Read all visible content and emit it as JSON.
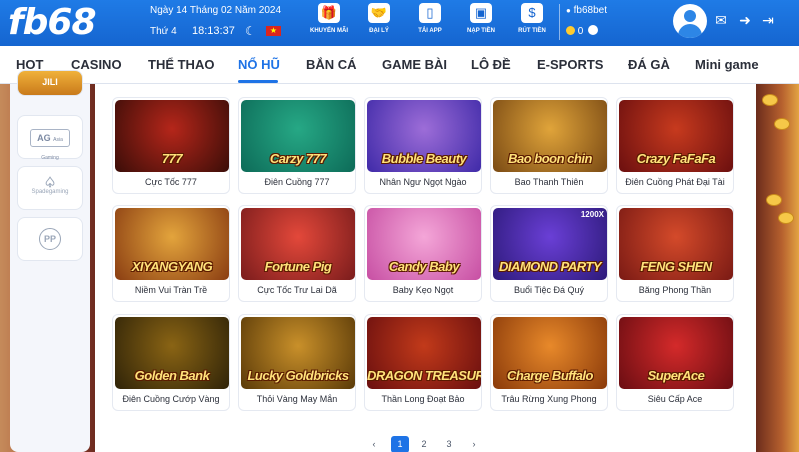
{
  "header": {
    "logo": "fb68",
    "date": "Ngày 14 Tháng 02 Năm 2024",
    "weekday": "Thứ 4",
    "time": "18:13:37",
    "theme_icon": "moon-icon",
    "flag": "vietnam-flag",
    "tools": [
      {
        "label": "KHUYẾN MÃI",
        "icon": "gift-icon"
      },
      {
        "label": "ĐẠI LÝ",
        "icon": "handshake-icon"
      },
      {
        "label": "TẢI APP",
        "icon": "phone-icon"
      },
      {
        "label": "NẠP TIỀN",
        "icon": "wallet-icon"
      },
      {
        "label": "RÚT TIỀN",
        "icon": "withdraw-icon"
      }
    ],
    "username": "fb68bet",
    "balance": "0",
    "icons": [
      "avatar-icon",
      "mail-icon",
      "login-icon",
      "logout-icon"
    ]
  },
  "nav": {
    "items": [
      "HOT",
      "CASINO",
      "THỂ THAO",
      "NỔ HŨ",
      "BẮN CÁ",
      "GAME BÀI",
      "LÔ ĐỀ",
      "E-SPORTS",
      "ĐÁ GÀ",
      "Mini game"
    ],
    "active": "NỔ HŨ"
  },
  "rail": {
    "items": [
      {
        "label": "JILI",
        "icon": "jili-logo"
      },
      {
        "label": "AG",
        "sub": "Asia Gaming",
        "icon": "ag-logo"
      },
      {
        "label": "Spadegaming",
        "icon": "spadegaming-logo"
      },
      {
        "label": "PP",
        "icon": "pp-logo"
      }
    ]
  },
  "games": [
    {
      "name": "Cực Tốc 777",
      "art": "777",
      "colors": [
        "#3a0d08",
        "#b5261a"
      ]
    },
    {
      "name": "Điên Cuồng 777",
      "art": "Carzy 777",
      "colors": [
        "#0d6b58",
        "#26a885"
      ]
    },
    {
      "name": "Nhân Ngư Ngọt Ngào",
      "art": "Bubble Beauty",
      "colors": [
        "#3f2aa8",
        "#9d6dd8"
      ]
    },
    {
      "name": "Bao Thanh Thiên",
      "art": "Bao boon chin",
      "colors": [
        "#7a4a14",
        "#e0a43a"
      ]
    },
    {
      "name": "Điên Cuồng Phát Đại Tài",
      "art": "Crazy FaFaFa",
      "colors": [
        "#6b0f0f",
        "#c73a1e"
      ]
    },
    {
      "name": "Niềm Vui Tràn Trề",
      "art": "XIYANGYANG",
      "colors": [
        "#8a3d12",
        "#e3a43c"
      ]
    },
    {
      "name": "Cực Tốc Trư Lai Dã",
      "art": "Fortune Pig",
      "colors": [
        "#7a1c1c",
        "#e3483a"
      ]
    },
    {
      "name": "Baby Kẹo Ngọt",
      "art": "Candy Baby",
      "colors": [
        "#c74fa3",
        "#f4a6d8"
      ]
    },
    {
      "name": "Buổi Tiệc Đá Quý",
      "art": "DIAMOND PARTY",
      "colors": [
        "#2d1a7a",
        "#6a3fd6"
      ]
    },
    {
      "name": "Băng Phong Thần",
      "art": "FENG SHEN",
      "colors": [
        "#7a1a14",
        "#d44a2a"
      ]
    },
    {
      "name": "Điên Cuồng Cướp Vàng",
      "art": "Golden Bank",
      "colors": [
        "#2f2308",
        "#8a6414"
      ]
    },
    {
      "name": "Thỏi Vàng May Mắn",
      "art": "Lucky Goldbricks",
      "colors": [
        "#5a3a08",
        "#c9902a"
      ]
    },
    {
      "name": "Thần Long Đoạt Bảo",
      "art": "DRAGON TREASURE",
      "colors": [
        "#6a0f0f",
        "#c23a1a"
      ]
    },
    {
      "name": "Trâu Rừng Xung Phong",
      "art": "Charge Buffalo",
      "colors": [
        "#8a3a0a",
        "#e8892a"
      ]
    },
    {
      "name": "Siêu Cấp Ace",
      "art": "SuperAce",
      "colors": [
        "#6a0d12",
        "#d42a2a"
      ]
    }
  ],
  "diamond_badge": "1200X",
  "pagination": {
    "prev": "‹",
    "pages": [
      "1",
      "2",
      "3"
    ],
    "active": "1",
    "next": "›"
  }
}
